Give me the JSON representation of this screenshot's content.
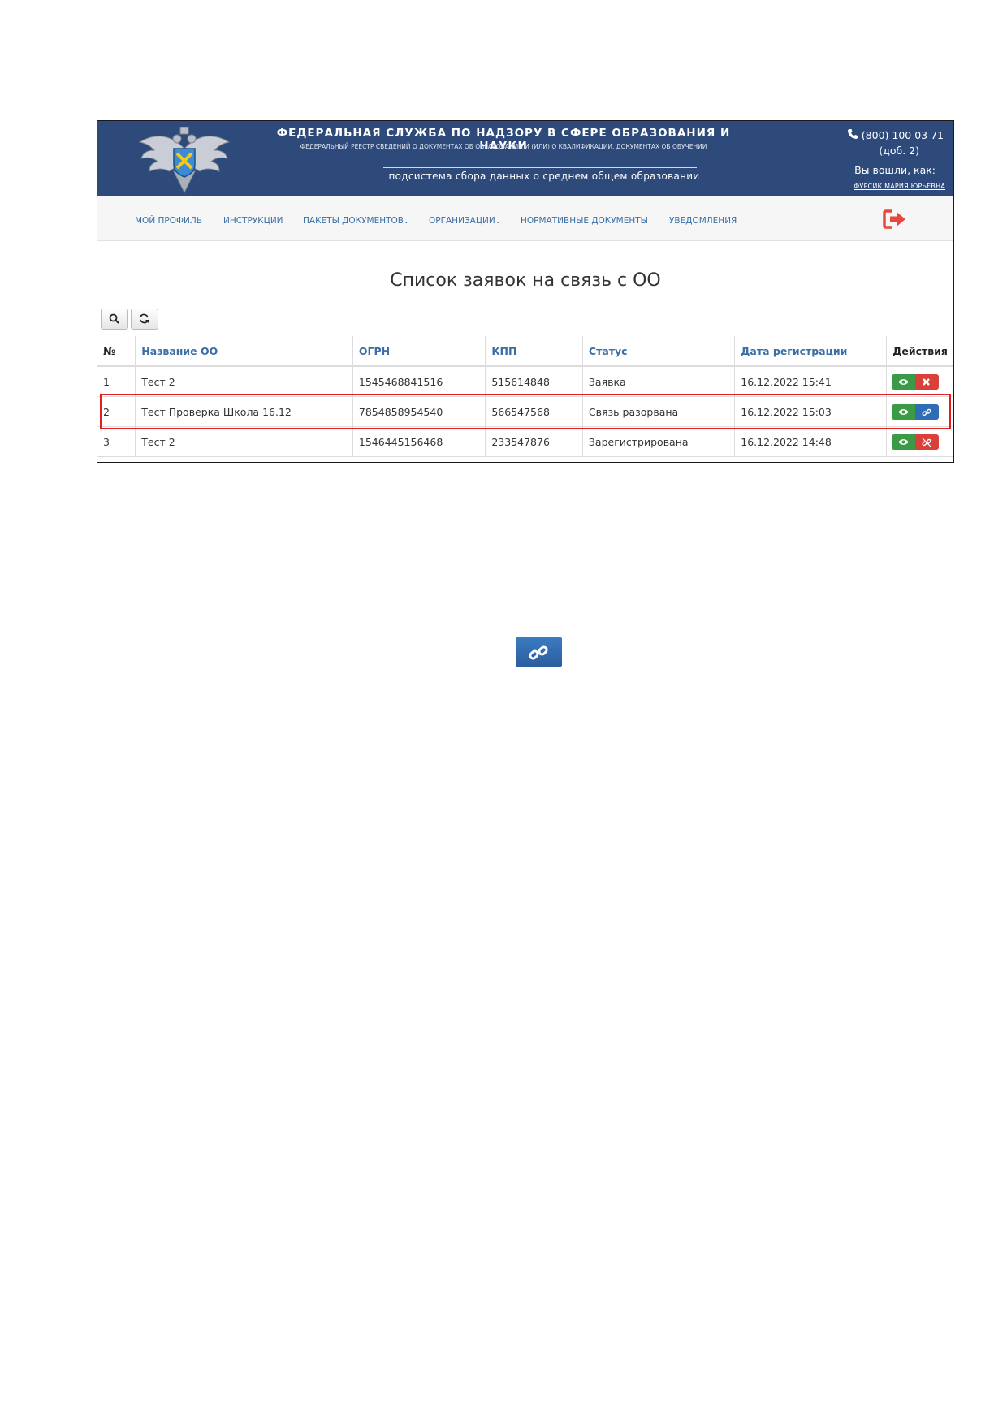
{
  "header": {
    "title": "ФЕДЕРАЛЬНАЯ СЛУЖБА ПО НАДЗОРУ В СФЕРЕ ОБРАЗОВАНИЯ И НАУКИ",
    "subtitle": "ФЕДЕРАЛЬНЫЙ РЕЕСТР СВЕДЕНИЙ О ДОКУМЕНТАХ ОБ ОБРАЗОВАНИИ И (ИЛИ) О КВАЛИФИКАЦИИ, ДОКУМЕНТАХ ОБ ОБУЧЕНИИ",
    "subsystem": "подсистема сбора данных о среднем общем образовании",
    "phone": "(800) 100 03 71",
    "phone_ext": "(доб. 2)",
    "logged_in_label": "Вы вошли, как:",
    "user_name": "ФУРСИК МАРИЯ ЮРЬЕВНА"
  },
  "nav": {
    "items": [
      {
        "label": "МОЙ ПРОФИЛЬ"
      },
      {
        "label": "ИНСТРУКЦИИ"
      },
      {
        "label": "ПАКЕТЫ ДОКУМЕНТОВ"
      },
      {
        "label": "ОРГАНИЗАЦИИ"
      },
      {
        "label": "НОРМАТИВНЫЕ ДОКУМЕНТЫ"
      },
      {
        "label": "УВЕДОМЛЕНИЯ"
      }
    ]
  },
  "page": {
    "title": "Список заявок на связь с ОО"
  },
  "table": {
    "headers": [
      "№",
      "Название ОО",
      "ОГРН",
      "КПП",
      "Статус",
      "Дата регистрации",
      "Действия"
    ],
    "rows": [
      [
        "1",
        "Тест 2",
        "1545468841516",
        "515614848",
        "Заявка",
        "16.12.2022 15:41"
      ],
      [
        "2",
        "Тест Проверка Школа 16.12",
        "7854858954540",
        "566547568",
        "Связь разорвана",
        "16.12.2022 15:03"
      ],
      [
        "3",
        "Тест 2",
        "1546445156468",
        "233547876",
        "Зарегистрирована",
        "16.12.2022 14:48"
      ]
    ]
  },
  "colors": {
    "header_bg": "#2d4a7a",
    "link": "#3a6ea5",
    "view_button": "#3a9a45",
    "delete_button": "#d9403a",
    "link_button": "#2f6db4",
    "highlight": "#e02020"
  },
  "icons": {
    "view": "eye-icon",
    "delete": "times-icon",
    "link": "link-icon",
    "unlink": "unlink-icon",
    "search": "search-icon",
    "refresh": "refresh-icon",
    "exit": "sign-out-icon",
    "phone": "phone-icon"
  }
}
